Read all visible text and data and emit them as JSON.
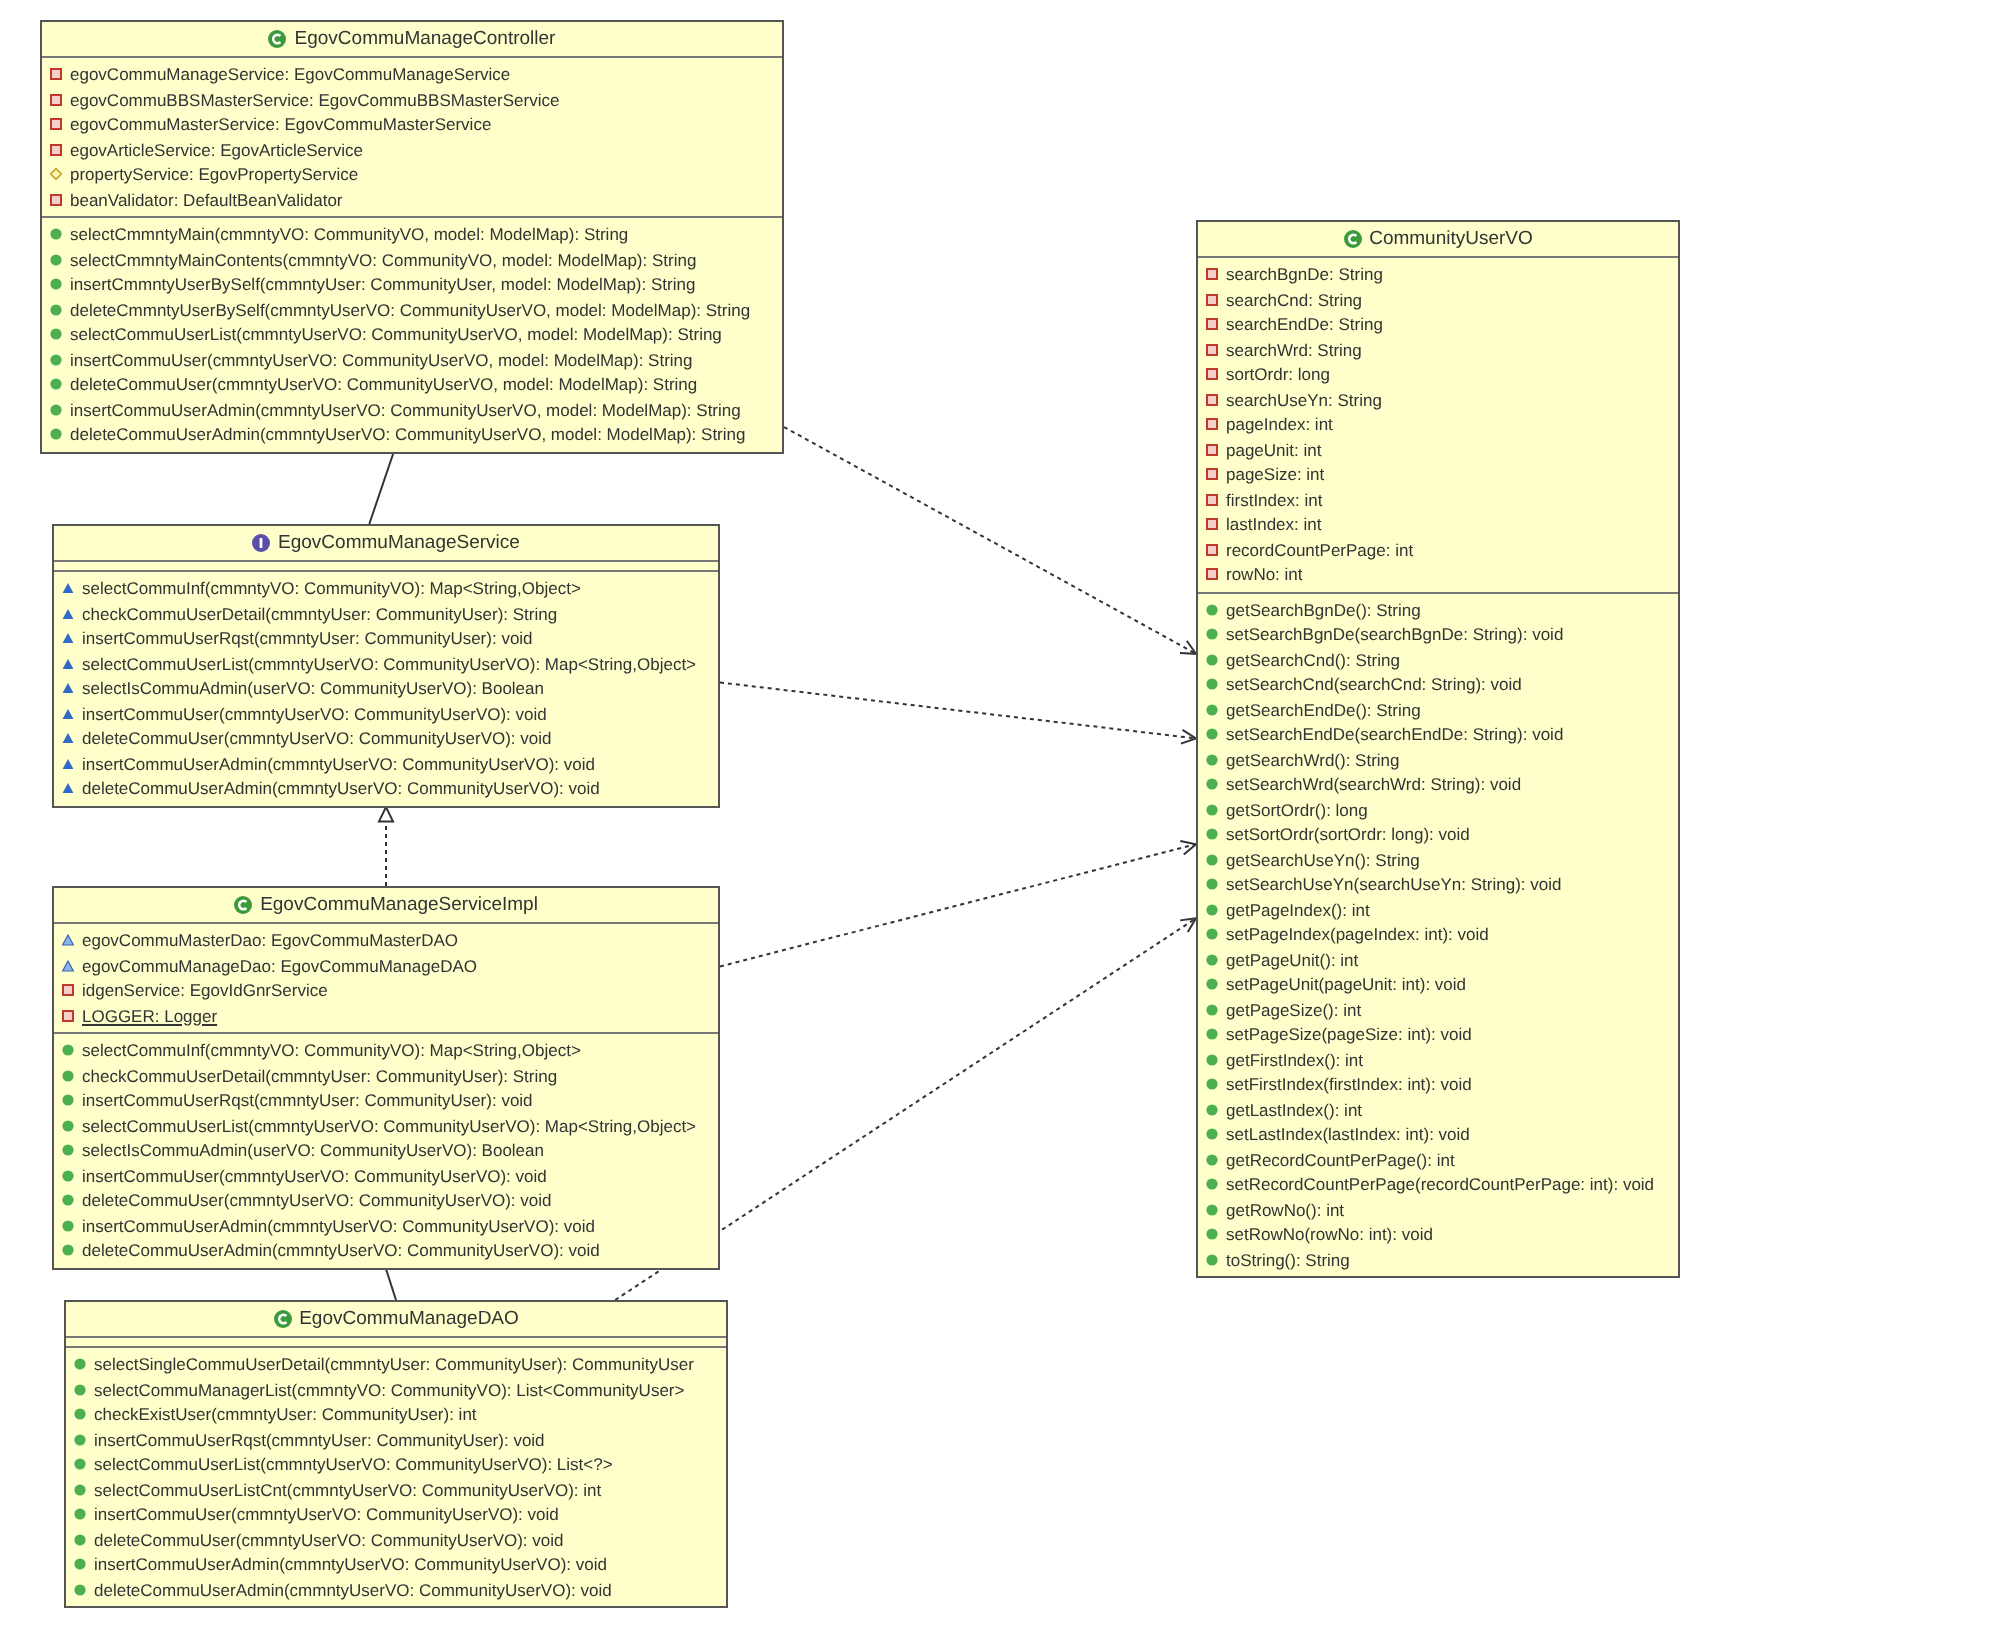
{
  "classes": [
    {
      "name": "EgovCommuManageController",
      "kind": "class",
      "attributes": [
        {
          "text": "egovCommuManageService: EgovCommuManageService",
          "kind": "private"
        },
        {
          "text": "egovCommuBBSMasterService: EgovCommuBBSMasterService",
          "kind": "private"
        },
        {
          "text": "egovCommuMasterService: EgovCommuMasterService",
          "kind": "private"
        },
        {
          "text": "egovArticleService: EgovArticleService",
          "kind": "private"
        },
        {
          "text": "propertyService: EgovPropertyService",
          "kind": "protected"
        },
        {
          "text": "beanValidator: DefaultBeanValidator",
          "kind": "private"
        }
      ],
      "operations": [
        {
          "text": "selectCmmntyMain(cmmntyVO: CommunityVO, model: ModelMap): String",
          "kind": "public"
        },
        {
          "text": "selectCmmntyMainContents(cmmntyVO: CommunityVO, model: ModelMap): String",
          "kind": "public"
        },
        {
          "text": "insertCmmntyUserBySelf(cmmntyUser: CommunityUser, model: ModelMap): String",
          "kind": "public"
        },
        {
          "text": "deleteCmmntyUserBySelf(cmmntyUserVO: CommunityUserVO, model: ModelMap): String",
          "kind": "public"
        },
        {
          "text": "selectCommuUserList(cmmntyUserVO: CommunityUserVO, model: ModelMap): String",
          "kind": "public"
        },
        {
          "text": "insertCommuUser(cmmntyUserVO: CommunityUserVO, model: ModelMap): String",
          "kind": "public"
        },
        {
          "text": "deleteCommuUser(cmmntyUserVO: CommunityUserVO, model: ModelMap): String",
          "kind": "public"
        },
        {
          "text": "insertCommuUserAdmin(cmmntyUserVO: CommunityUserVO, model: ModelMap): String",
          "kind": "public"
        },
        {
          "text": "deleteCommuUserAdmin(cmmntyUserVO: CommunityUserVO, model: ModelMap): String",
          "kind": "public"
        }
      ]
    },
    {
      "name": "EgovCommuManageService",
      "kind": "interface",
      "operations": [
        {
          "text": "selectCommuInf(cmmntyVO: CommunityVO): Map<String,Object>",
          "kind": "package"
        },
        {
          "text": "checkCommuUserDetail(cmmntyUser: CommunityUser): String",
          "kind": "package"
        },
        {
          "text": "insertCommuUserRqst(cmmntyUser: CommunityUser): void",
          "kind": "package"
        },
        {
          "text": "selectCommuUserList(cmmntyUserVO: CommunityUserVO): Map<String,Object>",
          "kind": "package"
        },
        {
          "text": "selectIsCommuAdmin(userVO: CommunityUserVO): Boolean",
          "kind": "package"
        },
        {
          "text": "insertCommuUser(cmmntyUserVO: CommunityUserVO): void",
          "kind": "package"
        },
        {
          "text": "deleteCommuUser(cmmntyUserVO: CommunityUserVO): void",
          "kind": "package"
        },
        {
          "text": "insertCommuUserAdmin(cmmntyUserVO: CommunityUserVO): void",
          "kind": "package"
        },
        {
          "text": "deleteCommuUserAdmin(cmmntyUserVO: CommunityUserVO): void",
          "kind": "package"
        }
      ]
    },
    {
      "name": "EgovCommuManageServiceImpl",
      "kind": "class",
      "attributes": [
        {
          "text": "egovCommuMasterDao: EgovCommuMasterDAO",
          "kind": "package",
          "static": false
        },
        {
          "text": "egovCommuManageDao: EgovCommuManageDAO",
          "kind": "package",
          "static": false
        },
        {
          "text": "idgenService: EgovIdGnrService",
          "kind": "private",
          "static": false
        },
        {
          "text": "LOGGER: Logger",
          "kind": "private",
          "static": true
        }
      ],
      "operations": [
        {
          "text": "selectCommuInf(cmmntyVO: CommunityVO): Map<String,Object>",
          "kind": "public"
        },
        {
          "text": "checkCommuUserDetail(cmmntyUser: CommunityUser): String",
          "kind": "public"
        },
        {
          "text": "insertCommuUserRqst(cmmntyUser: CommunityUser): void",
          "kind": "public"
        },
        {
          "text": "selectCommuUserList(cmmntyUserVO: CommunityUserVO): Map<String,Object>",
          "kind": "public"
        },
        {
          "text": "selectIsCommuAdmin(userVO: CommunityUserVO): Boolean",
          "kind": "public"
        },
        {
          "text": "insertCommuUser(cmmntyUserVO: CommunityUserVO): void",
          "kind": "public"
        },
        {
          "text": "deleteCommuUser(cmmntyUserVO: CommunityUserVO): void",
          "kind": "public"
        },
        {
          "text": "insertCommuUserAdmin(cmmntyUserVO: CommunityUserVO): void",
          "kind": "public"
        },
        {
          "text": "deleteCommuUserAdmin(cmmntyUserVO: CommunityUserVO): void",
          "kind": "public"
        }
      ]
    },
    {
      "name": "EgovCommuManageDAO",
      "kind": "class",
      "operations": [
        {
          "text": "selectSingleCommuUserDetail(cmmntyUser: CommunityUser): CommunityUser",
          "kind": "public"
        },
        {
          "text": "selectCommuManagerList(cmmntyVO: CommunityVO): List<CommunityUser>",
          "kind": "public"
        },
        {
          "text": "checkExistUser(cmmntyUser: CommunityUser): int",
          "kind": "public"
        },
        {
          "text": "insertCommuUserRqst(cmmntyUser: CommunityUser): void",
          "kind": "public"
        },
        {
          "text": "selectCommuUserList(cmmntyUserVO: CommunityUserVO): List<?>",
          "kind": "public"
        },
        {
          "text": "selectCommuUserListCnt(cmmntyUserVO: CommunityUserVO): int",
          "kind": "public"
        },
        {
          "text": "insertCommuUser(cmmntyUserVO: CommunityUserVO): void",
          "kind": "public"
        },
        {
          "text": "deleteCommuUser(cmmntyUserVO: CommunityUserVO): void",
          "kind": "public"
        },
        {
          "text": "insertCommuUserAdmin(cmmntyUserVO: CommunityUserVO): void",
          "kind": "public"
        },
        {
          "text": "deleteCommuUserAdmin(cmmntyUserVO: CommunityUserVO): void",
          "kind": "public"
        }
      ]
    },
    {
      "name": "CommunityUserVO",
      "kind": "class",
      "attributes": [
        {
          "text": "searchBgnDe: String",
          "kind": "private"
        },
        {
          "text": "searchCnd: String",
          "kind": "private"
        },
        {
          "text": "searchEndDe: String",
          "kind": "private"
        },
        {
          "text": "searchWrd: String",
          "kind": "private"
        },
        {
          "text": "sortOrdr: long",
          "kind": "private"
        },
        {
          "text": "searchUseYn: String",
          "kind": "private"
        },
        {
          "text": "pageIndex: int",
          "kind": "private"
        },
        {
          "text": "pageUnit: int",
          "kind": "private"
        },
        {
          "text": "pageSize: int",
          "kind": "private"
        },
        {
          "text": "firstIndex: int",
          "kind": "private"
        },
        {
          "text": "lastIndex: int",
          "kind": "private"
        },
        {
          "text": "recordCountPerPage: int",
          "kind": "private"
        },
        {
          "text": "rowNo: int",
          "kind": "private"
        }
      ],
      "operations": [
        {
          "text": "getSearchBgnDe(): String",
          "kind": "public"
        },
        {
          "text": "setSearchBgnDe(searchBgnDe: String): void",
          "kind": "public"
        },
        {
          "text": "getSearchCnd(): String",
          "kind": "public"
        },
        {
          "text": "setSearchCnd(searchCnd: String): void",
          "kind": "public"
        },
        {
          "text": "getSearchEndDe(): String",
          "kind": "public"
        },
        {
          "text": "setSearchEndDe(searchEndDe: String): void",
          "kind": "public"
        },
        {
          "text": "getSearchWrd(): String",
          "kind": "public"
        },
        {
          "text": "setSearchWrd(searchWrd: String): void",
          "kind": "public"
        },
        {
          "text": "getSortOrdr(): long",
          "kind": "public"
        },
        {
          "text": "setSortOrdr(sortOrdr: long): void",
          "kind": "public"
        },
        {
          "text": "getSearchUseYn(): String",
          "kind": "public"
        },
        {
          "text": "setSearchUseYn(searchUseYn: String): void",
          "kind": "public"
        },
        {
          "text": "getPageIndex(): int",
          "kind": "public"
        },
        {
          "text": "setPageIndex(pageIndex: int): void",
          "kind": "public"
        },
        {
          "text": "getPageUnit(): int",
          "kind": "public"
        },
        {
          "text": "setPageUnit(pageUnit: int): void",
          "kind": "public"
        },
        {
          "text": "getPageSize(): int",
          "kind": "public"
        },
        {
          "text": "setPageSize(pageSize: int): void",
          "kind": "public"
        },
        {
          "text": "getFirstIndex(): int",
          "kind": "public"
        },
        {
          "text": "setFirstIndex(firstIndex: int): void",
          "kind": "public"
        },
        {
          "text": "getLastIndex(): int",
          "kind": "public"
        },
        {
          "text": "setLastIndex(lastIndex: int): void",
          "kind": "public"
        },
        {
          "text": "getRecordCountPerPage(): int",
          "kind": "public"
        },
        {
          "text": "setRecordCountPerPage(recordCountPerPage: int): void",
          "kind": "public"
        },
        {
          "text": "getRowNo(): int",
          "kind": "public"
        },
        {
          "text": "setRowNo(rowNo: int): void",
          "kind": "public"
        },
        {
          "text": "toString(): String",
          "kind": "public"
        }
      ]
    }
  ],
  "relations": [
    {
      "kind": "association"
    },
    {
      "kind": "dependency"
    },
    {
      "kind": "dependency"
    },
    {
      "kind": "realization"
    },
    {
      "kind": "dependency"
    },
    {
      "kind": "association"
    },
    {
      "kind": "dependency"
    }
  ]
}
